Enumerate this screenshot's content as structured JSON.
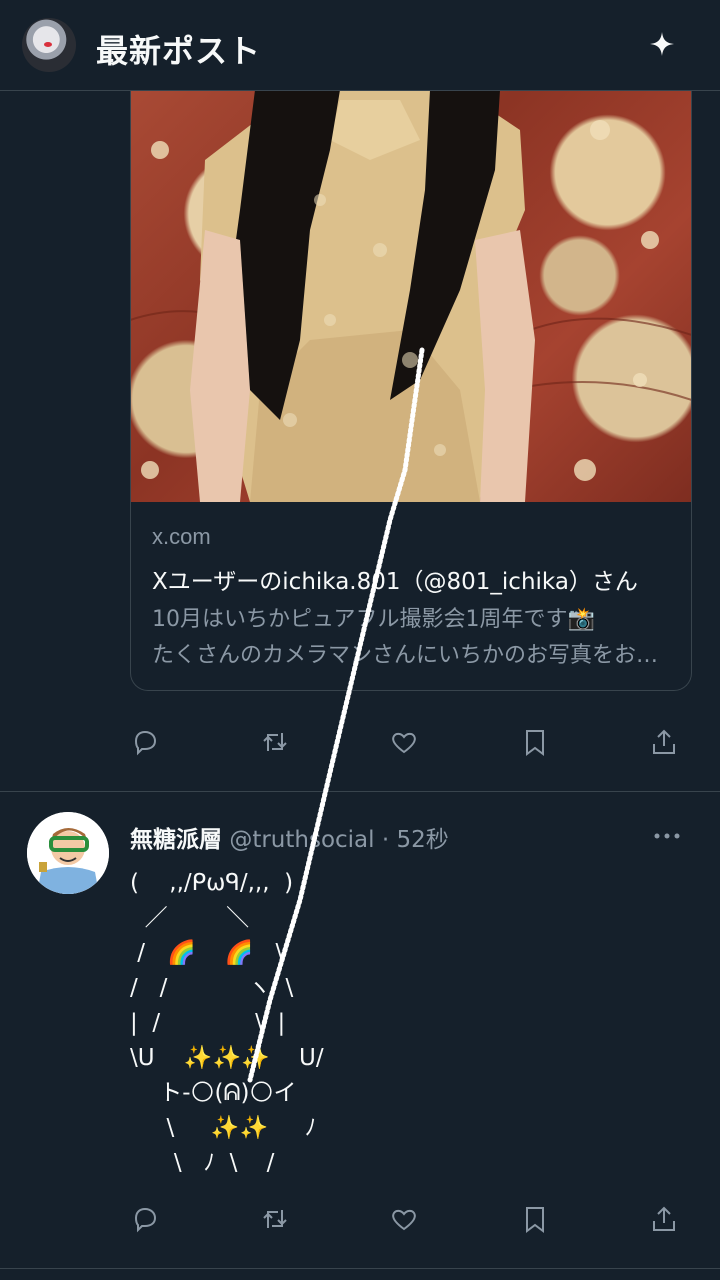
{
  "header": {
    "title": "最新ポスト",
    "sparkle_icon": "sparkle-icon"
  },
  "link_card": {
    "domain": "x.com",
    "title": "Xユーザーのichika.801（@801_ichika）さん",
    "desc_line1": "10月はいちかピュアフル撮影会1周年です📸",
    "desc_line2": "たくさんのカメラマンさんにいちかのお写真をお願いしました"
  },
  "tweet2": {
    "name": "無糖派層",
    "handle": "@truthsocial",
    "separator": "·",
    "time": "52秒",
    "ascii_art": "(　 ,,/ᑭωᑫ/,,,  )\n  ／        ＼\n /   🌈    🌈   \\\n/   /           ヽ  \\\n|  /             \\  |\n\\ᑌ    ✨✨✨    ᑌ/\n    ト-🌕(ᕱ)🌕イ\n     \\     ✨✨     ﾉ\n      \\   ﾉ  \\    /"
  },
  "actions": [
    "reply-icon",
    "repost-icon",
    "like-icon",
    "bookmark-icon",
    "share-icon"
  ],
  "colors": {
    "background": "#15202b",
    "border": "#38444d",
    "secondary_text": "#8b98a5",
    "text": "#f7f9f9"
  }
}
